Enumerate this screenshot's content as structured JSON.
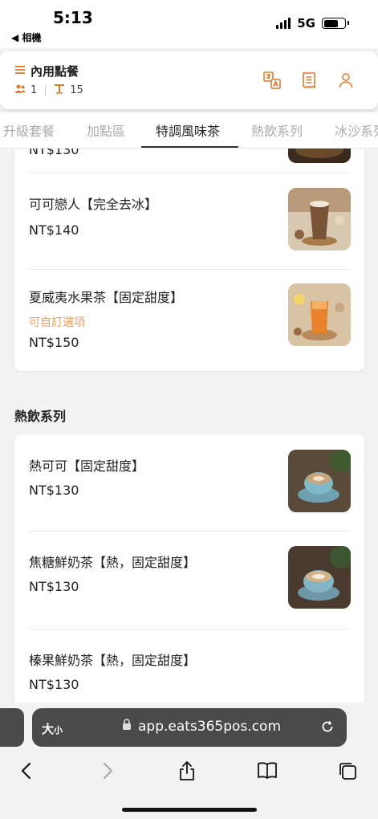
{
  "status": {
    "time": "5:13",
    "back_label": "◀ 相機",
    "network": "5G",
    "battery_level": 0.7
  },
  "header": {
    "title": "內用點餐",
    "guests": "1",
    "table": "15",
    "accent_color": "#e07b2e"
  },
  "tabs": [
    {
      "label": "升級套餐"
    },
    {
      "label": "加點區"
    },
    {
      "label": "特調風味茶"
    },
    {
      "label": "熱飲系列"
    },
    {
      "label": "冰沙系列"
    }
  ],
  "active_tab": 2,
  "section1": {
    "partial_price": "NT$130",
    "items": [
      {
        "name": "可可戀人【完全去冰】",
        "price": "NT$140"
      },
      {
        "name": "夏威夷水果茶【固定甜度】",
        "note": "可自訂選項",
        "price": "NT$150"
      }
    ]
  },
  "section2": {
    "title": "熱飲系列",
    "items": [
      {
        "name": "熱可可【固定甜度】",
        "price": "NT$130"
      },
      {
        "name": "焦糖鮮奶茶【熱，固定甜度】",
        "price": "NT$130"
      },
      {
        "name": "榛果鮮奶茶【熱，固定甜度】",
        "price": "NT$130"
      }
    ]
  },
  "browser": {
    "text_size_label": "大",
    "text_size_small": "小",
    "url": "app.eats365pos.com"
  }
}
